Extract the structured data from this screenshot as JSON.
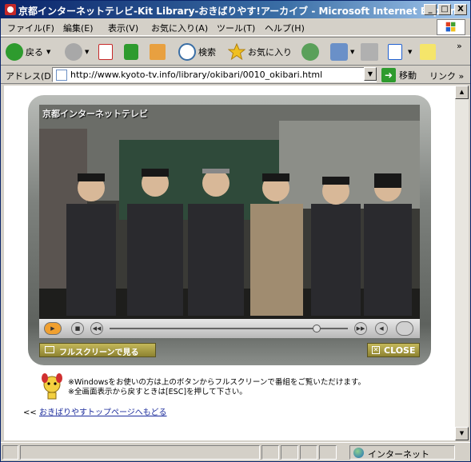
{
  "window": {
    "title": "京都インターネットテレビ-Kit Library-おきばりやす!アーカイブ - Microsoft Internet Explorer",
    "minimize": "_",
    "maximize": "□",
    "close": "X"
  },
  "menu": [
    "ファイル(F)",
    "編集(E)",
    "表示(V)",
    "お気に入り(A)",
    "ツール(T)",
    "ヘルプ(H)"
  ],
  "toolbar": {
    "back": "戻る",
    "search": "検索",
    "favorites": "お気に入り"
  },
  "address": {
    "label": "アドレス(D)",
    "url": "http://www.kyoto-tv.info/library/okibari/0010_okibari.html",
    "go": "移動",
    "links": "リンク",
    "more": "»"
  },
  "player": {
    "caption": "京都インターネットテレビ",
    "seek_position": 0.87,
    "fullscreen_label": "フルスクリーンで見る",
    "close_label": "CLOSE"
  },
  "page": {
    "note_line1": "※Windowsをお使いの方は上のボタンからフルスクリーンで番組をご覧いただけます。",
    "note_line2": "※全画面表示から戻すときは[ESC]を押して下さい。",
    "back_prefix": "<<",
    "back_link": "おきばりやすトップページへもどる"
  },
  "status": {
    "zone": "インターネット"
  },
  "colors": {
    "titlebar": "#0a246a",
    "chrome": "#d4d0c8",
    "player_button": "#a89c40",
    "link": "#1c2c9c"
  }
}
